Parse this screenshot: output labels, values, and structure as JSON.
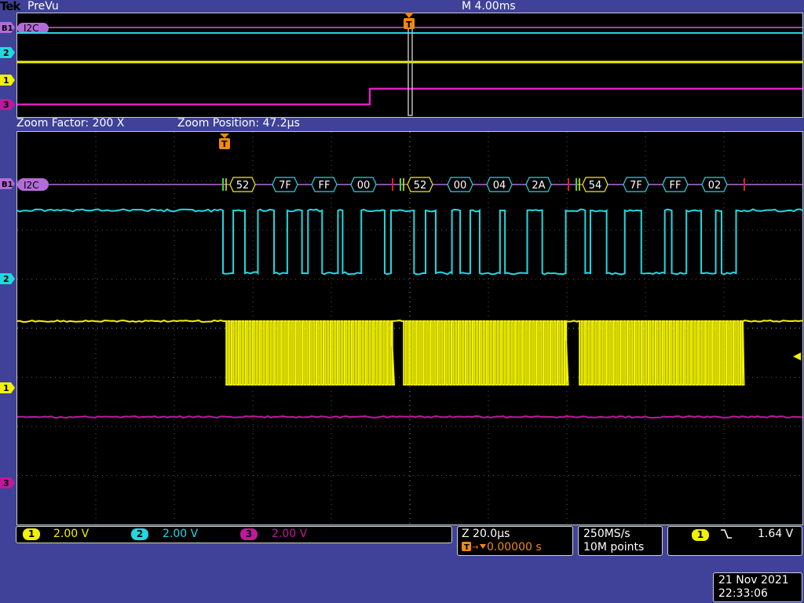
{
  "header": {
    "brand": "Tek",
    "mode": "PreVu",
    "main_timebase": "M 4.00ms"
  },
  "overview": {
    "bus_label": "B1",
    "bus_name": "I2C",
    "trigger_marker": "T",
    "channel_markers": [
      "2",
      "1",
      "3"
    ]
  },
  "zoom": {
    "factor_label": "Zoom Factor: 200 X",
    "position_label": "Zoom Position: 47.2µs"
  },
  "main": {
    "bus_label": "B1",
    "bus_name": "I2C",
    "trigger_marker": "T",
    "channel_markers": [
      "2",
      "1",
      "3"
    ],
    "decode_packets": [
      "52",
      "7F",
      "FF",
      "00",
      "52",
      "00",
      "04",
      "2A",
      "54",
      "7F",
      "FF",
      "02"
    ]
  },
  "channels": [
    {
      "number": "1",
      "scale": "2.00 V",
      "color": "#f2f200"
    },
    {
      "number": "2",
      "scale": "2.00 V",
      "color": "#22d8e0"
    },
    {
      "number": "3",
      "scale": "2.00 V",
      "color": "#c0189c"
    }
  ],
  "zoom_box": {
    "timebase": "Z 20.0µs",
    "trigger_position": "0.00000 s"
  },
  "acquisition": {
    "sample_rate": "250MS/s",
    "record_length": "10M points"
  },
  "trigger": {
    "source": "1",
    "level": "1.64 V"
  },
  "datetime": {
    "date": "21 Nov 2021",
    "time": "22:33:06"
  }
}
